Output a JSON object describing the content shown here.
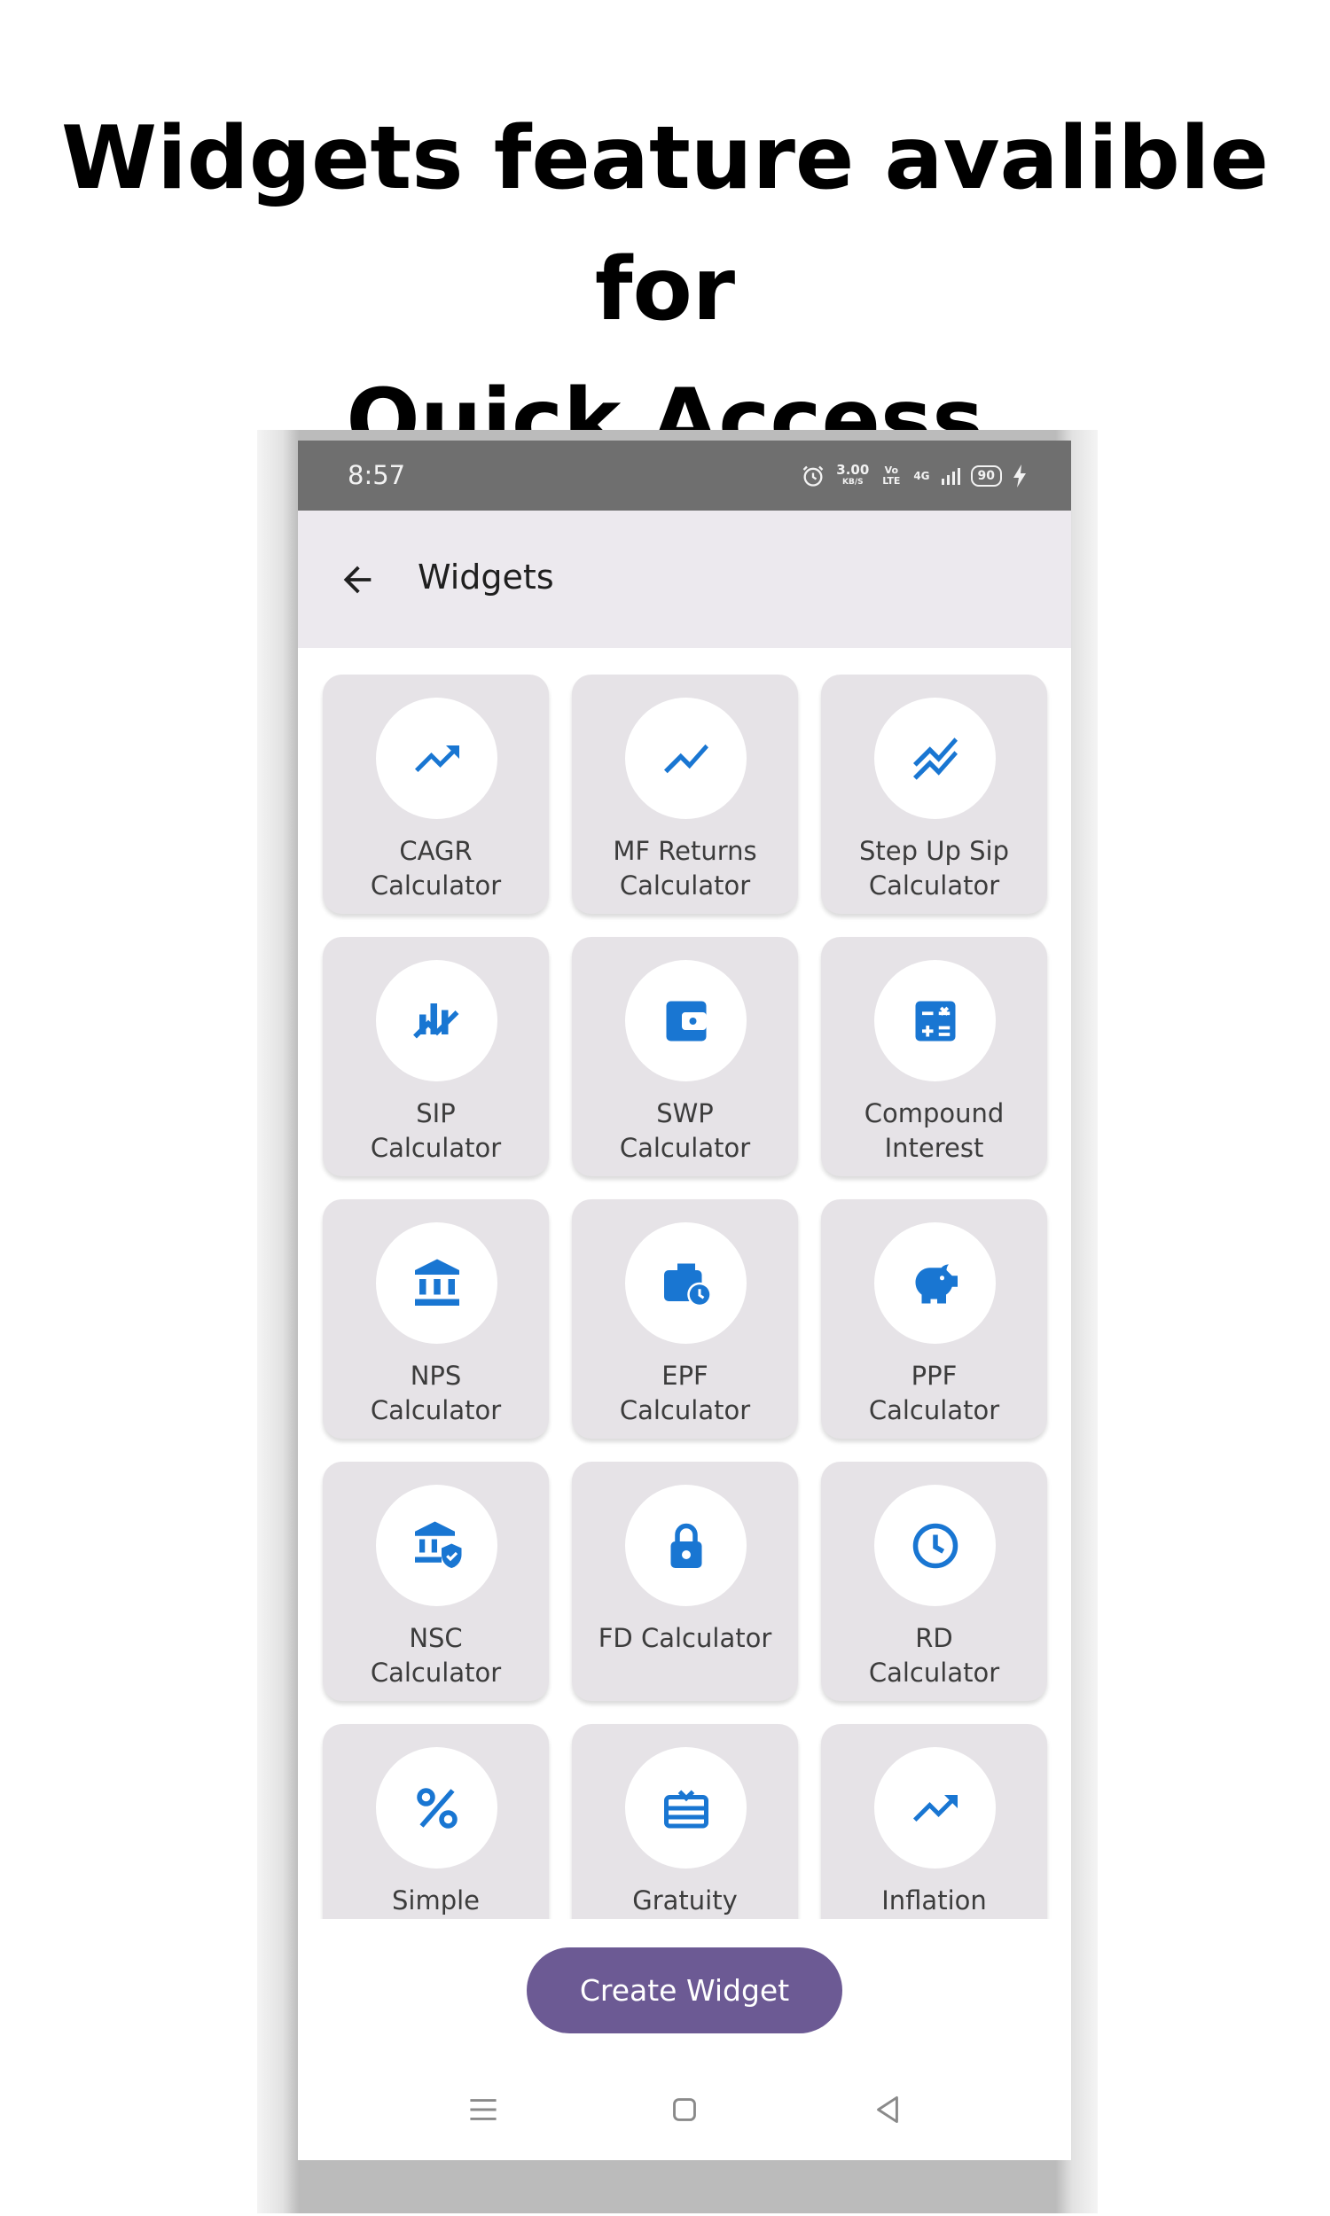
{
  "headline": {
    "line1": "Widgets feature avalible for",
    "line2": "Quick Access"
  },
  "status_bar": {
    "time": "8:57",
    "speed_value": "3.00",
    "speed_unit": "KB/S",
    "volte": "Vo LTE",
    "network": "4G",
    "battery": "90"
  },
  "app_bar": {
    "title": "Widgets"
  },
  "widgets": [
    {
      "line1": "CAGR",
      "line2": "Calculator",
      "icon": "trending-up-icon"
    },
    {
      "line1": "MF Returns",
      "line2": "Calculator",
      "icon": "show-chart-icon"
    },
    {
      "line1": "Step Up Sip",
      "line2": "Calculator",
      "icon": "stacked-line-chart-icon"
    },
    {
      "line1": "SIP",
      "line2": "Calculator",
      "icon": "ssid-chart-icon"
    },
    {
      "line1": "SWP",
      "line2": "Calculator",
      "icon": "wallet-icon"
    },
    {
      "line1": "Compound",
      "line2": "Interest",
      "icon": "calculate-icon"
    },
    {
      "line1": "NPS",
      "line2": "Calculator",
      "icon": "bank-icon"
    },
    {
      "line1": "EPF",
      "line2": "Calculator",
      "icon": "work-history-icon"
    },
    {
      "line1": "PPF",
      "line2": "Calculator",
      "icon": "piggy-bank-icon"
    },
    {
      "line1": "NSC",
      "line2": "Calculator",
      "icon": "bank-shield-icon"
    },
    {
      "line1": "FD Calculator",
      "line2": "",
      "icon": "lock-icon"
    },
    {
      "line1": "RD",
      "line2": "Calculator",
      "icon": "clock-icon"
    },
    {
      "line1": "Simple",
      "line2": "",
      "icon": "percent-icon"
    },
    {
      "line1": "Gratuity",
      "line2": "",
      "icon": "gift-card-icon"
    },
    {
      "line1": "Inflation",
      "line2": "",
      "icon": "trending-up-icon"
    }
  ],
  "create_button": {
    "label": "Create Widget"
  },
  "nav_bar": {
    "icons": [
      "menu-icon",
      "home-icon",
      "back-triangle-icon"
    ]
  },
  "colors": {
    "accent": "#1976d2",
    "button": "#6c5a94",
    "card": "#e6e3e7",
    "app_bar": "#ece9ee",
    "status_bar": "#6f6f6f"
  }
}
